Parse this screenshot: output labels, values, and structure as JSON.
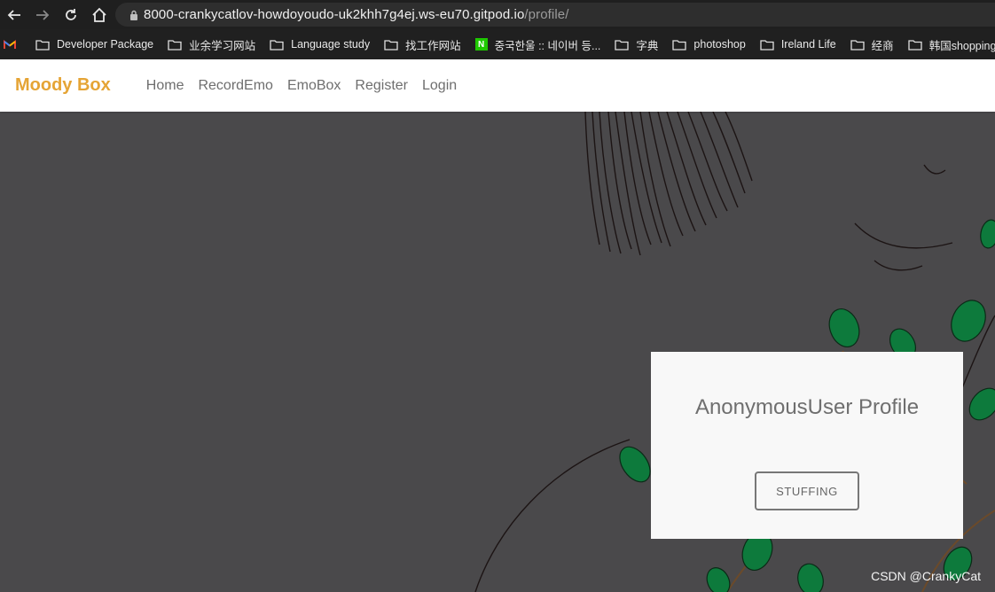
{
  "browser": {
    "url_host": "8000-crankycatlov-howdoyoudo-uk2khh7g4ej.ws-eu70.gitpod.io",
    "url_path": "/profile/",
    "bookmarks": [
      {
        "label": "Developer Package"
      },
      {
        "label": "业余学习网站"
      },
      {
        "label": "Language study"
      },
      {
        "label": "找工作网站"
      },
      {
        "label": "중국한울 :: 네이버 등..."
      },
      {
        "label": "字典"
      },
      {
        "label": "photoshop"
      },
      {
        "label": "Ireland Life"
      },
      {
        "label": "经商"
      },
      {
        "label": "韩国shopping"
      }
    ],
    "naver_letter": "N"
  },
  "navbar": {
    "brand": "Moody Box",
    "links": [
      "Home",
      "RecordEmo",
      "EmoBox",
      "Register",
      "Login"
    ],
    "brand_color": "#e5a435"
  },
  "profile": {
    "title": "AnonymousUser Profile",
    "button": "STUFFING"
  },
  "watermark": "CSDN @CrankyCat"
}
